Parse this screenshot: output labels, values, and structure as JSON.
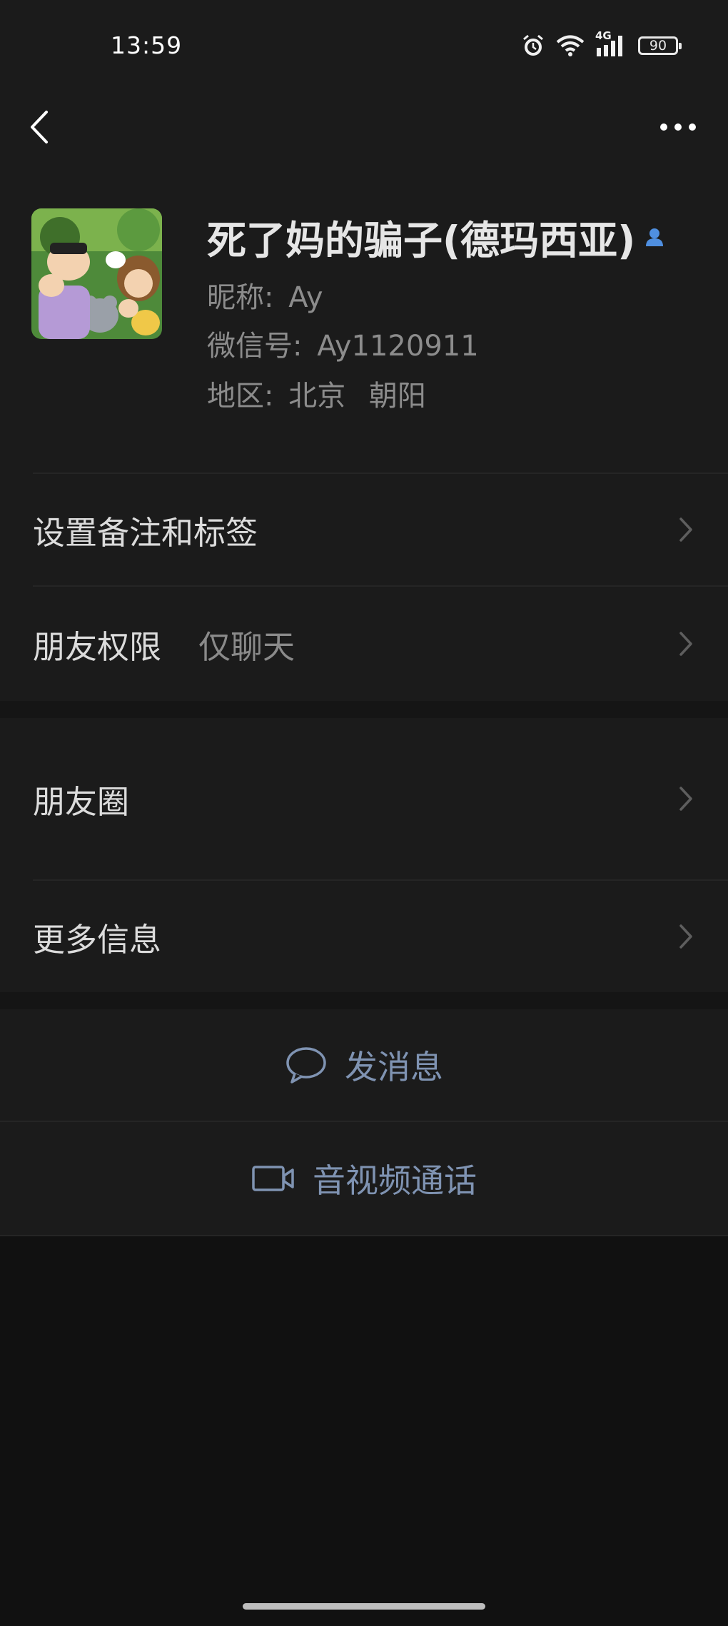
{
  "status_bar": {
    "time": "13:59",
    "network": "4G",
    "battery": "90",
    "icons": [
      "alarm-icon",
      "wifi-icon",
      "signal-icon",
      "battery-icon"
    ]
  },
  "nav": {
    "back_icon": "chevron-left-icon",
    "more_icon": "more-dots-icon"
  },
  "profile": {
    "display_name": "死了妈的骗子(德玛西亚)",
    "nickname_label": "昵称:",
    "nickname": "Ay",
    "wechat_id_label": "微信号:",
    "wechat_id": "Ay1120911",
    "region_label": "地区:",
    "region_city": "北京",
    "region_district": "朝阳",
    "contact_icon": "person-icon"
  },
  "menu": {
    "remarks_tags": "设置备注和标签",
    "friend_permissions": "朋友权限",
    "friend_permissions_value": "仅聊天",
    "moments": "朋友圈",
    "more_info": "更多信息"
  },
  "actions": {
    "send_message": "发消息",
    "av_call": "音视频通话"
  },
  "colors": {
    "background": "#111111",
    "panel": "#1b1b1b",
    "action_link": "#7f93b2",
    "contact_badge": "#4f8fe0"
  }
}
